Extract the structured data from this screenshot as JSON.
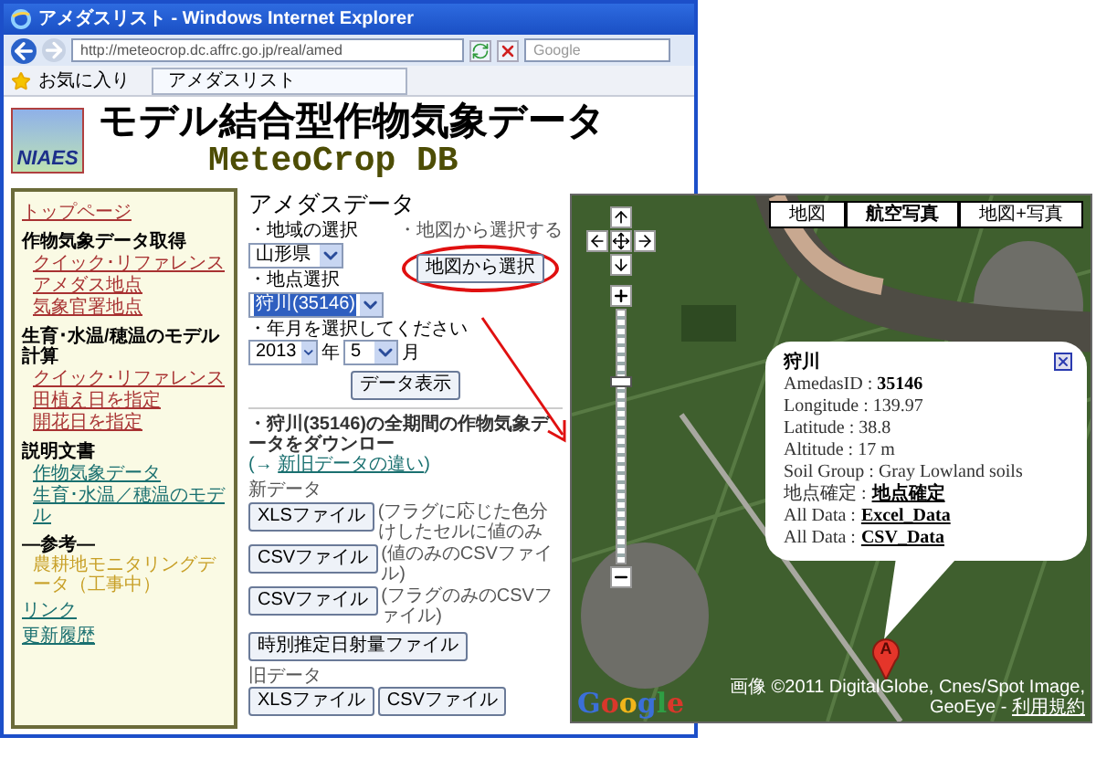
{
  "window": {
    "title": "アメダスリスト - Windows Internet Explorer"
  },
  "address_bar": {
    "value": "http://meteocrop.dc.affrc.go.jp/real/amed"
  },
  "search": {
    "placeholder": "Google"
  },
  "favorites": {
    "label": "お気に入り"
  },
  "tabs": [
    {
      "label": "アメダスリスト",
      "selected": true
    }
  ],
  "header": {
    "logo": "NIAES",
    "title": "モデル結合型作物気象データ",
    "subtitle": "MeteoCrop DB"
  },
  "sidebar": {
    "items": [
      {
        "kind": "link",
        "label": "トップページ",
        "color": "#a83232"
      },
      {
        "kind": "heading",
        "label": "作物気象データ取得"
      },
      {
        "kind": "sublink",
        "label": "クイック･リファレンス",
        "color": "#a83232"
      },
      {
        "kind": "sublink",
        "label": "アメダス地点",
        "color": "#a83232"
      },
      {
        "kind": "sublink",
        "label": "気象官署地点",
        "color": "#a83232"
      },
      {
        "kind": "heading",
        "label": "生育･水温/穂温のモデル計算"
      },
      {
        "kind": "sublink",
        "label": "クイック･リファレンス",
        "color": "#a83232"
      },
      {
        "kind": "sublink",
        "label": "田植え日を指定",
        "color": "#a83232"
      },
      {
        "kind": "sublink",
        "label": "開花日を指定",
        "color": "#a83232"
      },
      {
        "kind": "heading",
        "label": "説明文書"
      },
      {
        "kind": "sublink",
        "label": "作物気象データ",
        "color": "#1a7070"
      },
      {
        "kind": "sublink",
        "label": "生育･水温／穂温のモデル",
        "color": "#1a7070"
      },
      {
        "kind": "heading",
        "label": "―参考―"
      },
      {
        "kind": "note",
        "label": "農耕地モニタリングデータ（工事中）",
        "color": "#c8a028"
      },
      {
        "kind": "link",
        "label": "リンク",
        "color": "#1a7070"
      },
      {
        "kind": "link",
        "label": "更新履歴",
        "color": "#1a7070"
      }
    ]
  },
  "main": {
    "title": "アメダスデータ",
    "region": {
      "label": "・地域の選択",
      "value": "山形県",
      "focused": false
    },
    "station": {
      "label": "・地点選択",
      "value": "狩川(35146)",
      "focused": true
    },
    "date": {
      "label": "・年月を選択してください",
      "year": "2013",
      "year_unit": "年",
      "month": "5",
      "month_unit": "月"
    },
    "map_pick": {
      "label": "・地図から選択する",
      "button": "地図から選択",
      "highlighted": true
    },
    "show_button": "データ表示"
  },
  "download": {
    "text": "・狩川(35146)の全期間の作物気象データをダウンロー",
    "link_prefix": "(→",
    "link": "新旧データの違い",
    "link_suffix": ")",
    "new_data": {
      "label": "新データ",
      "files": [
        {
          "button": "XLSファイル",
          "note": "(フラグに応じた色分けしたセルに値のみ"
        },
        {
          "button": "CSVファイル",
          "note": "(値のみのCSVファイル)"
        },
        {
          "button": "CSVファイル",
          "note": "(フラグのみのCSVファイル)"
        }
      ]
    },
    "solar_button": "時別推定日射量ファイル",
    "old_data": {
      "label": "旧データ",
      "buttons": [
        "XLSファイル",
        "CSVファイル"
      ]
    }
  },
  "map": {
    "types": [
      {
        "label": "地図",
        "selected": false
      },
      {
        "label": "航空写真",
        "selected": true
      },
      {
        "label": "地図+写真",
        "selected": false
      }
    ],
    "zoom": {
      "level": 0.72
    },
    "info": {
      "name": "狩川",
      "rows": [
        {
          "kind": "bold",
          "label": "AmedasID :",
          "value": "35146"
        },
        {
          "kind": "plain",
          "label": "Longitude :",
          "value": "139.97"
        },
        {
          "kind": "plain",
          "label": "Latitude :",
          "value": "38.8"
        },
        {
          "kind": "plain",
          "label": "Altitude :",
          "value": "17 m"
        },
        {
          "kind": "plain",
          "label": "Soil Group :",
          "value": "Gray Lowland soils"
        },
        {
          "kind": "link",
          "label": "地点確定 :",
          "value": "地点確定"
        },
        {
          "kind": "link",
          "label": "All Data :",
          "value": "Excel_Data"
        },
        {
          "kind": "link",
          "label": "All Data :",
          "value": "CSV_Data"
        }
      ]
    },
    "marker": "A",
    "logo": "Google",
    "attribution": "画像 ©2011 DigitalGlobe, Cnes/Spot Image, GeoEye -",
    "terms": "利用規約"
  }
}
